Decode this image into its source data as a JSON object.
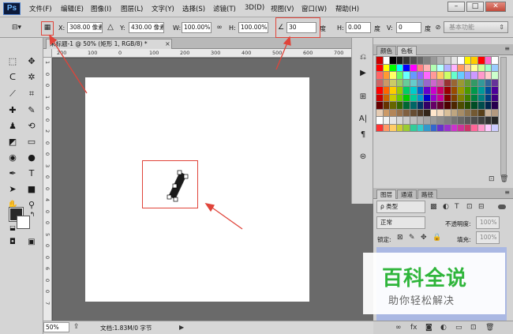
{
  "app": {
    "logo": "Ps",
    "menu": [
      "文件(F)",
      "编辑(E)",
      "图像(I)",
      "图层(L)",
      "文字(Y)",
      "选择(S)",
      "滤镜(T)",
      "3D(D)",
      "视图(V)",
      "窗口(W)",
      "帮助(H)"
    ],
    "window_controls": {
      "minimize": "–",
      "maximize": "□",
      "close": "✕"
    }
  },
  "options_bar": {
    "x_label": "X:",
    "x_value": "308.00 像素",
    "y_label": "Y:",
    "y_value": "430.00 像素",
    "w_label": "W:",
    "w_value": "100.00%",
    "h_label": "H:",
    "h_value": "100.00%",
    "angle_value": "30",
    "angle_unit": "度",
    "hskew_label": "H:",
    "hskew_value": "0.00",
    "hskew_unit": "度",
    "vskew_label": "V:",
    "vskew_value": "0",
    "vskew_unit": "度",
    "workspace": "基本功能"
  },
  "document": {
    "tab_title": "未标题-1 @ 50% (矩形 1, RGB/8) *",
    "tab_close": "×",
    "ruler_top": [
      "200",
      "100",
      "0",
      "100",
      "200",
      "300",
      "400",
      "500",
      "600",
      "700",
      "800"
    ],
    "ruler_left": [
      "1",
      "0",
      "0",
      "1",
      "0",
      "0",
      "2",
      "0",
      "0",
      "3",
      "0",
      "0",
      "4",
      "0",
      "0",
      "5",
      "0",
      "0",
      "6",
      "0",
      "0",
      "7"
    ],
    "status_zoom": "50%",
    "status_info": "文档:1.83M/0 字节"
  },
  "color_panel": {
    "tabs": [
      "颜色",
      "色板"
    ],
    "active_tab": "色板",
    "swatches": [
      [
        "#cc0000",
        "#ffffff",
        "#000000",
        "#1a1a1a",
        "#333333",
        "#4d4d4d",
        "#666666",
        "#808080",
        "#999999",
        "#b3b3b3",
        "#cccccc",
        "#e6e6e6",
        "#ffffff",
        "#fff200",
        "#ffcc00",
        "#ff0000",
        "#ff66cc",
        "#ffffff"
      ],
      [
        "#ff0000",
        "#ffff00",
        "#00ff00",
        "#00ffff",
        "#0000ff",
        "#ff00ff",
        "#ff8080",
        "#ffb3b3",
        "#b3ffb3",
        "#b3ffff",
        "#b3b3ff",
        "#ffb3ff",
        "#ff9966",
        "#ffcc99",
        "#ffff99",
        "#ccff99",
        "#99ffcc",
        "#99ccff"
      ],
      [
        "#ff6666",
        "#ff9933",
        "#ffff66",
        "#66ff66",
        "#66ffff",
        "#6699ff",
        "#9966ff",
        "#ff66ff",
        "#ff9999",
        "#ffcc66",
        "#ccff66",
        "#66ffcc",
        "#66ccff",
        "#9999ff",
        "#cc99ff",
        "#ff99cc",
        "#ffcccc",
        "#ccffcc"
      ],
      [
        "#cc6666",
        "#cc9966",
        "#cccc66",
        "#99cc66",
        "#66cc99",
        "#66cccc",
        "#6699cc",
        "#9966cc",
        "#cc66cc",
        "#cc6699",
        "#993333",
        "#996633",
        "#999933",
        "#669933",
        "#339966",
        "#339999",
        "#336699",
        "#663399"
      ],
      [
        "#ff0000",
        "#ff6600",
        "#ffcc00",
        "#99cc00",
        "#00cc66",
        "#00cccc",
        "#0066cc",
        "#6600cc",
        "#cc00cc",
        "#cc0066",
        "#990000",
        "#994c00",
        "#999900",
        "#4c9900",
        "#00994c",
        "#009999",
        "#004c99",
        "#4c0099"
      ],
      [
        "#cc0000",
        "#cc6600",
        "#cccc00",
        "#66cc00",
        "#00cc00",
        "#00cc99",
        "#0099cc",
        "#0000cc",
        "#9900cc",
        "#cc0099",
        "#800000",
        "#804000",
        "#808000",
        "#408000",
        "#008040",
        "#008080",
        "#004080",
        "#400080"
      ],
      [
        "#660000",
        "#663300",
        "#666600",
        "#336600",
        "#006633",
        "#006666",
        "#003366",
        "#330066",
        "#660066",
        "#660033",
        "#4d0000",
        "#4d2600",
        "#4d4d00",
        "#264d00",
        "#004d26",
        "#004d4d",
        "#00264d",
        "#26004d"
      ],
      [
        "#e6ccb3",
        "#cc9966",
        "#b38659",
        "#99734d",
        "#806040",
        "#664d33",
        "#4d3926",
        "#33261a",
        "#ffe6cc",
        "#f2d9bf",
        "#d9bf99",
        "#bfa680",
        "#a68c66",
        "#8c734d",
        "#735933",
        "#59401a",
        "#ccb399",
        "#b39980"
      ],
      [
        "#ffffff",
        "#f2f2f2",
        "#e6e6e6",
        "#d9d9d9",
        "#cccccc",
        "#bfbfbf",
        "#b3b3b3",
        "#a6a6a6",
        "#999999",
        "#8c8c8c",
        "#808080",
        "#737373",
        "#666666",
        "#595959",
        "#4d4d4d",
        "#404040",
        "#333333",
        "#262626"
      ],
      [
        "#ff3333",
        "#ff9966",
        "#ffcc66",
        "#cccc33",
        "#99cc33",
        "#33cc99",
        "#33cccc",
        "#3399cc",
        "#3366cc",
        "#6633cc",
        "#9933cc",
        "#cc33cc",
        "#cc3399",
        "#cc3366",
        "#ff6699",
        "#ff99cc",
        "#ffccff",
        "#ccccff"
      ]
    ]
  },
  "layers_panel": {
    "tabs": [
      "图层",
      "通道",
      "路径"
    ],
    "active_tab": "图层",
    "filter": "ρ 类型",
    "blend_mode": "正常",
    "opacity_label": "不透明度:",
    "opacity_value": "100%",
    "lock_label": "锁定:",
    "fill_label": "填充:",
    "fill_value": "100%"
  },
  "watermark": {
    "title": "百科全说",
    "subtitle": "助你轻松解决"
  },
  "annotation_color": "#e0443a"
}
